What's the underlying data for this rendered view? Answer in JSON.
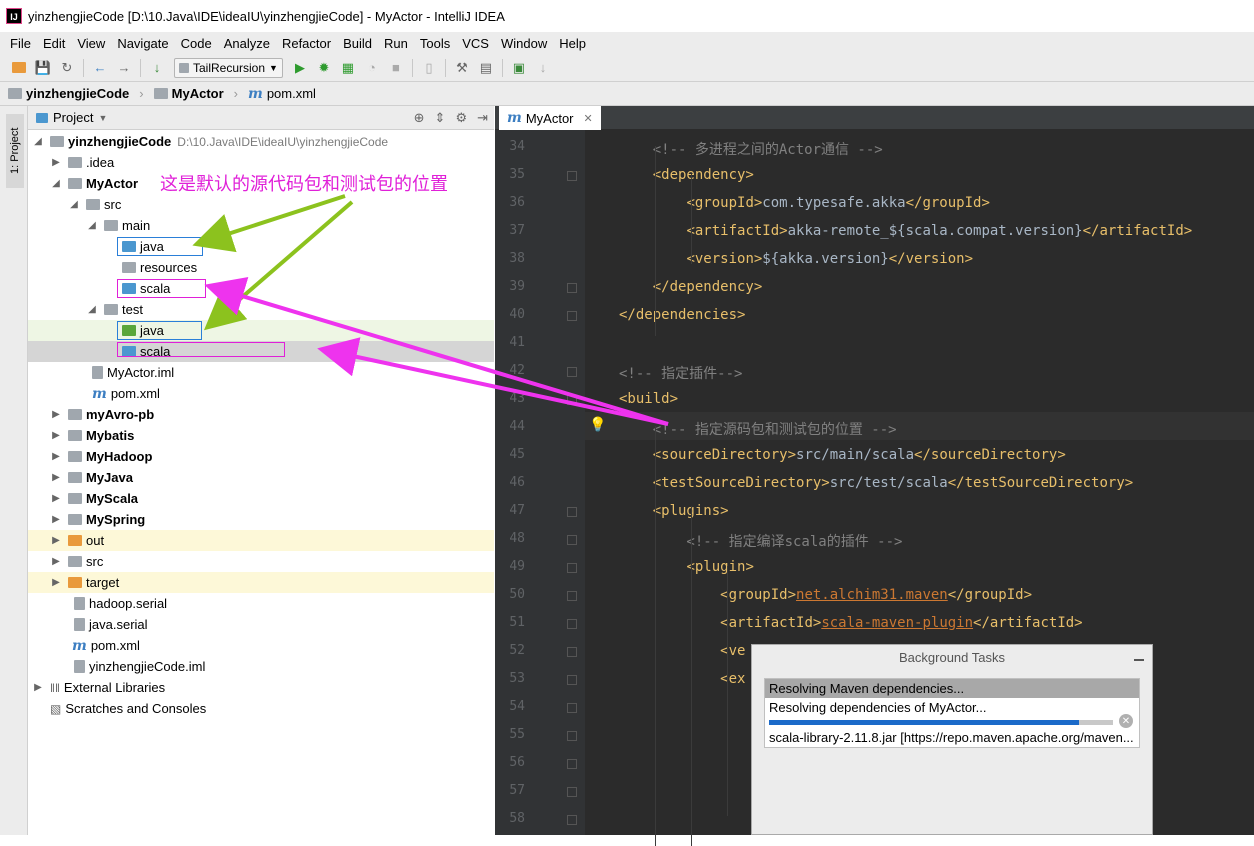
{
  "window": {
    "title": "yinzhengjieCode [D:\\10.Java\\IDE\\ideaIU\\yinzhengjieCode] - MyActor - IntelliJ IDEA",
    "app_icon": "IJ"
  },
  "menu": [
    "File",
    "Edit",
    "View",
    "Navigate",
    "Code",
    "Analyze",
    "Refactor",
    "Build",
    "Run",
    "Tools",
    "VCS",
    "Window",
    "Help"
  ],
  "toolbar": {
    "run_config": "TailRecursion"
  },
  "breadcrumbs": [
    "yinzhengjieCode",
    "MyActor",
    "pom.xml"
  ],
  "sidebar": {
    "tab": "1: Project"
  },
  "project_panel": {
    "title": "Project"
  },
  "tree": [
    {
      "label": "yinzhengjieCode",
      "path": "D:\\10.Java\\IDE\\ideaIU\\yinzhengjieCode"
    },
    {
      "label": ".idea"
    },
    {
      "label": "MyActor"
    },
    {
      "label": "src"
    },
    {
      "label": "main"
    },
    {
      "label": "java"
    },
    {
      "label": "resources"
    },
    {
      "label": "scala"
    },
    {
      "label": "test"
    },
    {
      "label": "java"
    },
    {
      "label": "scala"
    },
    {
      "label": "MyActor.iml"
    },
    {
      "label": "pom.xml"
    },
    {
      "label": "myAvro-pb"
    },
    {
      "label": "Mybatis"
    },
    {
      "label": "MyHadoop"
    },
    {
      "label": "MyJava"
    },
    {
      "label": "MyScala"
    },
    {
      "label": "MySpring"
    },
    {
      "label": "out"
    },
    {
      "label": "src"
    },
    {
      "label": "target"
    },
    {
      "label": "hadoop.serial"
    },
    {
      "label": "java.serial"
    },
    {
      "label": "pom.xml"
    },
    {
      "label": "yinzhengjieCode.iml"
    },
    {
      "label": "External Libraries"
    },
    {
      "label": "Scratches and Consoles"
    }
  ],
  "annotation": "这是默认的源代码包和测试包的位置",
  "editor": {
    "tab": "MyActor",
    "lines": [
      {
        "n": "34",
        "t": "    <!-- 多进程之间的Actor通信 -->"
      },
      {
        "n": "35",
        "t": "    <dependency>"
      },
      {
        "n": "36",
        "t": "        <groupId>com.typesafe.akka</groupId>"
      },
      {
        "n": "37",
        "t": "        <artifactId>akka-remote_${scala.compat.version}</artifactId>"
      },
      {
        "n": "38",
        "t": "        <version>${akka.version}</version>"
      },
      {
        "n": "39",
        "t": "    </dependency>"
      },
      {
        "n": "40",
        "t": "</dependencies>"
      },
      {
        "n": "41",
        "t": ""
      },
      {
        "n": "42",
        "t": "<!-- 指定插件-->"
      },
      {
        "n": "43",
        "t": "<build>"
      },
      {
        "n": "44",
        "t": "    <!-- 指定源码包和测试包的位置 -->"
      },
      {
        "n": "45",
        "t": "    <sourceDirectory>src/main/scala</sourceDirectory>"
      },
      {
        "n": "46",
        "t": "    <testSourceDirectory>src/test/scala</testSourceDirectory>"
      },
      {
        "n": "47",
        "t": "    <plugins>"
      },
      {
        "n": "48",
        "t": "        <!-- 指定编译scala的插件 -->"
      },
      {
        "n": "49",
        "t": "        <plugin>"
      },
      {
        "n": "50",
        "t": "            <groupId>net.alchim31.maven</groupId>"
      },
      {
        "n": "51",
        "t": "            <artifactId>scala-maven-plugin</artifactId>"
      },
      {
        "n": "52",
        "t": "            <ve"
      },
      {
        "n": "53",
        "t": "            <ex"
      },
      {
        "n": "54",
        "t": ""
      },
      {
        "n": "55",
        "t": ""
      },
      {
        "n": "56",
        "t": ""
      },
      {
        "n": "57",
        "t": ""
      },
      {
        "n": "58",
        "t": ""
      }
    ]
  },
  "background_tasks": {
    "title": "Background Tasks",
    "task": "Resolving Maven dependencies...",
    "subtask": "Resolving dependencies of MyActor...",
    "detail": "scala-library-2.11.8.jar [https://repo.maven.apache.org/maven...",
    "progress": 0.9
  }
}
